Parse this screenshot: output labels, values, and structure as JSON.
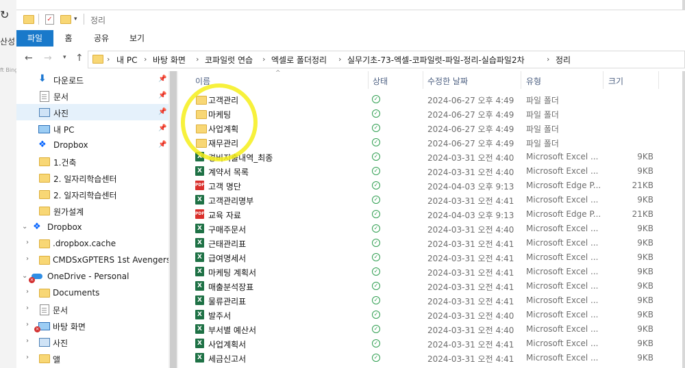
{
  "background_window": {
    "side_text": "산성",
    "faint_text": "ft Bing"
  },
  "titlebar": {
    "title": "정리"
  },
  "ribbon": {
    "tabs": [
      "파일",
      "홈",
      "공유",
      "보기"
    ]
  },
  "address": {
    "crumbs": [
      "내 PC",
      "바탕 화면",
      "코파일럿 연습",
      "엑셀로 폴더정리",
      "실무기초-73-엑셀-코파일럿-파일-정리-실습파일2차",
      "정리"
    ]
  },
  "nav": {
    "quick_access": [
      {
        "label": "다운로드",
        "icon": "download-icon",
        "pinned": true
      },
      {
        "label": "문서",
        "icon": "document-icon",
        "pinned": true
      },
      {
        "label": "사진",
        "icon": "pictures-icon",
        "pinned": true,
        "selected": true
      },
      {
        "label": "내 PC",
        "icon": "pc-icon",
        "pinned": true
      },
      {
        "label": "Dropbox",
        "icon": "dropbox-icon",
        "pinned": true
      },
      {
        "label": "1.건축",
        "icon": "folder-icon"
      },
      {
        "label": "2. 일자리학습센터",
        "icon": "folder-icon"
      },
      {
        "label": "2. 일자리학습센터",
        "icon": "folder-icon"
      },
      {
        "label": "원가설계",
        "icon": "folder-icon"
      }
    ],
    "dropbox_root": "Dropbox",
    "dropbox_children": [
      ".dropbox.cache",
      "CMDSxGPTERS 1st Avengers"
    ],
    "onedrive_root": "OneDrive - Personal",
    "onedrive_children": [
      "Documents",
      "문서",
      "바탕 화면",
      "사진",
      "앨"
    ]
  },
  "table": {
    "headers": [
      "이름",
      "상태",
      "수정한 날짜",
      "유형",
      "크기"
    ],
    "rows": [
      {
        "icon": "folder",
        "name": "고객관리",
        "date": "2024-06-27 오후 4:49",
        "type": "파일 폴더",
        "size": ""
      },
      {
        "icon": "folder",
        "name": "마케팅",
        "date": "2024-06-27 오후 4:49",
        "type": "파일 폴더",
        "size": ""
      },
      {
        "icon": "folder",
        "name": "사업계획",
        "date": "2024-06-27 오후 4:49",
        "type": "파일 폴더",
        "size": ""
      },
      {
        "icon": "folder",
        "name": "재무관리",
        "date": "2024-06-27 오후 4:49",
        "type": "파일 폴더",
        "size": ""
      },
      {
        "icon": "excel",
        "name": "경비지출내역_최종",
        "date": "2024-03-31 오전 4:40",
        "type": "Microsoft Excel ...",
        "size": "9KB"
      },
      {
        "icon": "excel",
        "name": "계약서 목록",
        "date": "2024-03-31 오전 4:40",
        "type": "Microsoft Excel ...",
        "size": "9KB"
      },
      {
        "icon": "pdf",
        "name": "고객 명단",
        "date": "2024-04-03 오후 9:13",
        "type": "Microsoft Edge P...",
        "size": "21KB"
      },
      {
        "icon": "excel",
        "name": "고객관리명부",
        "date": "2024-03-31 오전 4:41",
        "type": "Microsoft Excel ...",
        "size": "9KB"
      },
      {
        "icon": "pdf",
        "name": "교육 자료",
        "date": "2024-04-03 오후 9:13",
        "type": "Microsoft Edge P...",
        "size": "21KB"
      },
      {
        "icon": "excel",
        "name": "구매주문서",
        "date": "2024-03-31 오전 4:40",
        "type": "Microsoft Excel ...",
        "size": "9KB"
      },
      {
        "icon": "excel",
        "name": "근태관리표",
        "date": "2024-03-31 오전 4:41",
        "type": "Microsoft Excel ...",
        "size": "9KB"
      },
      {
        "icon": "excel",
        "name": "급여명세서",
        "date": "2024-03-31 오전 4:41",
        "type": "Microsoft Excel ...",
        "size": "9KB"
      },
      {
        "icon": "excel",
        "name": "마케팅 계획서",
        "date": "2024-03-31 오전 4:41",
        "type": "Microsoft Excel ...",
        "size": "9KB"
      },
      {
        "icon": "excel",
        "name": "매출분석장표",
        "date": "2024-03-31 오전 4:41",
        "type": "Microsoft Excel ...",
        "size": "9KB"
      },
      {
        "icon": "excel",
        "name": "물류관리표",
        "date": "2024-03-31 오전 4:41",
        "type": "Microsoft Excel ...",
        "size": "9KB"
      },
      {
        "icon": "excel",
        "name": "발주서",
        "date": "2024-03-31 오전 4:40",
        "type": "Microsoft Excel ...",
        "size": "9KB"
      },
      {
        "icon": "excel",
        "name": "부서별 예산서",
        "date": "2024-03-31 오전 4:40",
        "type": "Microsoft Excel ...",
        "size": "9KB"
      },
      {
        "icon": "excel",
        "name": "사업계획서",
        "date": "2024-03-31 오전 4:41",
        "type": "Microsoft Excel ...",
        "size": "9KB"
      },
      {
        "icon": "excel",
        "name": "세금신고서",
        "date": "2024-03-31 오전 4:41",
        "type": "Microsoft Excel ...",
        "size": "9KB"
      }
    ]
  },
  "colors": {
    "accent": "#1979ca",
    "highlight": "#f6ee1a",
    "status_ok": "#2e9e4f"
  }
}
